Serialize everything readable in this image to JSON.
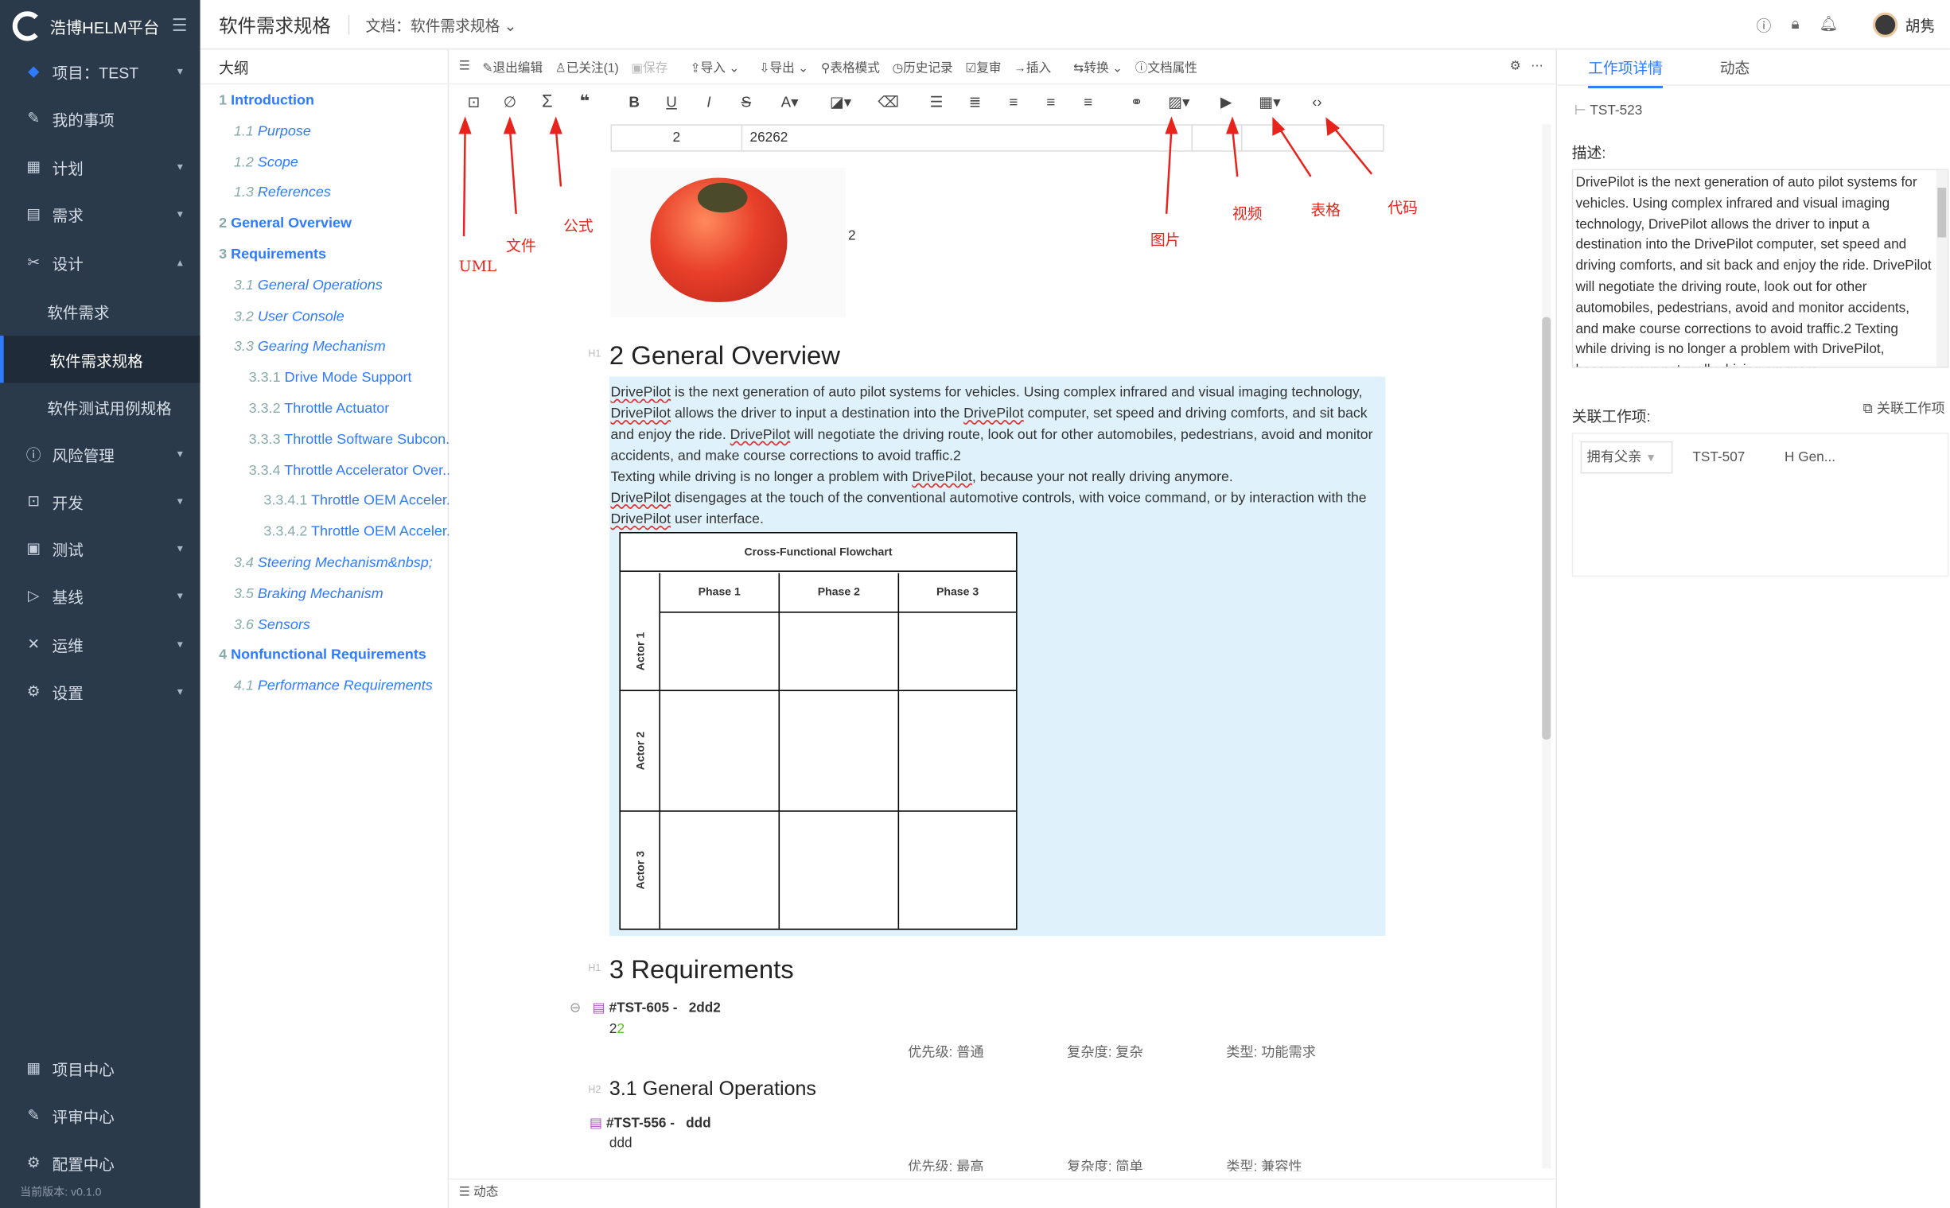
{
  "app": {
    "name": "浩博HELM平台",
    "version": "当前版本: v0.1.0"
  },
  "sidebar": {
    "project": "项目：TEST",
    "items": [
      {
        "label": "我的事项",
        "icon": "edit-icon"
      },
      {
        "label": "计划",
        "icon": "calendar-icon"
      },
      {
        "label": "需求",
        "icon": "list-icon"
      },
      {
        "label": "设计",
        "icon": "design-icon"
      },
      {
        "label": "软件需求",
        "icon": ""
      },
      {
        "label": "软件需求规格",
        "icon": ""
      },
      {
        "label": "软件测试用例规格",
        "icon": ""
      },
      {
        "label": "风险管理",
        "icon": "shield-icon"
      },
      {
        "label": "开发",
        "icon": "code-icon"
      },
      {
        "label": "测试",
        "icon": "test-icon"
      },
      {
        "label": "基线",
        "icon": "baseline-icon"
      },
      {
        "label": "运维",
        "icon": "tools-icon"
      },
      {
        "label": "设置",
        "icon": "gear-icon"
      }
    ],
    "bottom": [
      {
        "label": "项目中心",
        "icon": "grid-icon"
      },
      {
        "label": "评审中心",
        "icon": "review-icon"
      },
      {
        "label": "配置中心",
        "icon": "gear-icon"
      }
    ]
  },
  "header": {
    "title": "软件需求规格",
    "doc": "文档：软件需求规格",
    "user": "胡隽"
  },
  "outline": {
    "title": "大纲",
    "items": [
      {
        "num": "1",
        "text": "Introduction",
        "style": "b"
      },
      {
        "num": "1.1",
        "text": "Purpose",
        "style": "i"
      },
      {
        "num": "1.2",
        "text": "Scope",
        "style": "i"
      },
      {
        "num": "1.3",
        "text": "References",
        "style": "i"
      },
      {
        "num": "2",
        "text": "General Overview",
        "style": "b"
      },
      {
        "num": "3",
        "text": "Requirements",
        "style": "b"
      },
      {
        "num": "3.1",
        "text": "General Operations",
        "style": "i"
      },
      {
        "num": "3.2",
        "text": "User Console",
        "style": "i"
      },
      {
        "num": "3.3",
        "text": "Gearing Mechanism",
        "style": "i"
      },
      {
        "num": "3.3.1",
        "text": "Drive Mode Support",
        "style": ""
      },
      {
        "num": "3.3.2",
        "text": "Throttle Actuator",
        "style": ""
      },
      {
        "num": "3.3.3",
        "text": "Throttle Software Subcon...",
        "style": ""
      },
      {
        "num": "3.3.4",
        "text": "Throttle Accelerator Over...",
        "style": ""
      },
      {
        "num": "3.3.4.1",
        "text": "Throttle OEM Acceler...",
        "style": ""
      },
      {
        "num": "3.3.4.2",
        "text": "Throttle OEM Acceler...",
        "style": ""
      },
      {
        "num": "3.4",
        "text": "Steering Mechanism&nbsp;",
        "style": "i"
      },
      {
        "num": "3.5",
        "text": "Braking Mechanism",
        "style": "i"
      },
      {
        "num": "3.6",
        "text": "Sensors",
        "style": "i"
      },
      {
        "num": "4",
        "text": "Nonfunctional Requirements",
        "style": "b"
      },
      {
        "num": "4.1",
        "text": "Performance Requirements",
        "style": "i"
      }
    ]
  },
  "toolbar": {
    "exit_edit": "退出编辑",
    "follow": "已关注(1)",
    "save": "保存",
    "import": "导入",
    "export": "导出",
    "table_mode": "表格模式",
    "history": "历史记录",
    "review": "复审",
    "insert": "插入",
    "convert": "转换",
    "doc_props": "文档属性"
  },
  "table_row": {
    "c1": "2",
    "c2": "26262"
  },
  "image_caption": "2",
  "doc": {
    "h2_overview": "2 General Overview",
    "para": [
      [
        "DrivePilot",
        " is the next generation of auto pilot systems for vehicles. Using complex infrared and visual imaging technology, "
      ],
      [
        "DrivePilot",
        " allows the driver to input a destination into the "
      ],
      [
        "DrivePilot",
        " computer, set speed and driving comforts, and sit back and enjoy the ride. "
      ],
      [
        "DrivePilot",
        " will negotiate the driving route, look out for other automobiles, pedestrians, avoid and monitor accidents, and make course corrections to avoid traffic.2"
      ]
    ],
    "para2": "Texting while driving is no longer a problem with ",
    "para2_link": "DrivePilot",
    "para2_end": ", because your not really driving anymore.",
    "para3_link": "DrivePilot",
    "para3": " disengages at the touch of the conventional automotive controls, with voice command, or by interaction with the ",
    "para3_link2": "DrivePilot",
    "para3_end": " user interface.",
    "flowchart": {
      "title": "Cross-Functional Flowchart",
      "phases": [
        "Phase 1",
        "Phase 2",
        "Phase 3"
      ],
      "actors": [
        "Actor 1",
        "Actor 2",
        "Actor 3"
      ]
    },
    "h1_req": "3 Requirements",
    "req1": {
      "id": "#TST-605 -",
      "title": "2dd2",
      "body": "2",
      "body_green": "2",
      "priority": "优先级: 普通",
      "complexity": "复杂度: 复杂",
      "type": "类型: 功能需求"
    },
    "h2_ops": "3.1 General Operations",
    "req2": {
      "id": "#TST-556 -",
      "title": "ddd",
      "body": "ddd",
      "priority": "优先级: 最高",
      "complexity": "复杂度: 简单",
      "type": "类型: 兼容性"
    },
    "footer": "动态"
  },
  "annotations": {
    "uml": "UML",
    "file": "文件",
    "formula": "公式",
    "image": "图片",
    "video": "视频",
    "table": "表格",
    "code": "代码"
  },
  "right_panel": {
    "tabs": [
      "工作项详情",
      "动态"
    ],
    "id": "TST-523",
    "desc_label": "描述:",
    "description": "DrivePilot is the next generation of auto pilot systems for vehicles. Using complex infrared and visual imaging technology, DrivePilot allows the driver to input a destination into the DrivePilot computer, set speed and driving comforts, and sit back and enjoy the ride. DrivePilot will negotiate the driving route, look out for other automobiles, pedestrians, avoid and monitor accidents, and make course corrections to avoid traffic.2 Texting while driving is no longer a problem with DrivePilot, because your not really driving anymore.",
    "linked_label": "关联工作项:",
    "linked_button": "关联工作项",
    "relation": "拥有父亲",
    "linked_id": "TST-507",
    "linked_title": "H  Gen..."
  },
  "colors": {
    "sidebar_bg": "#2b3a4b",
    "accent": "#2e7bff",
    "highlight": "#dff2fc",
    "annotation": "#e8231b"
  }
}
